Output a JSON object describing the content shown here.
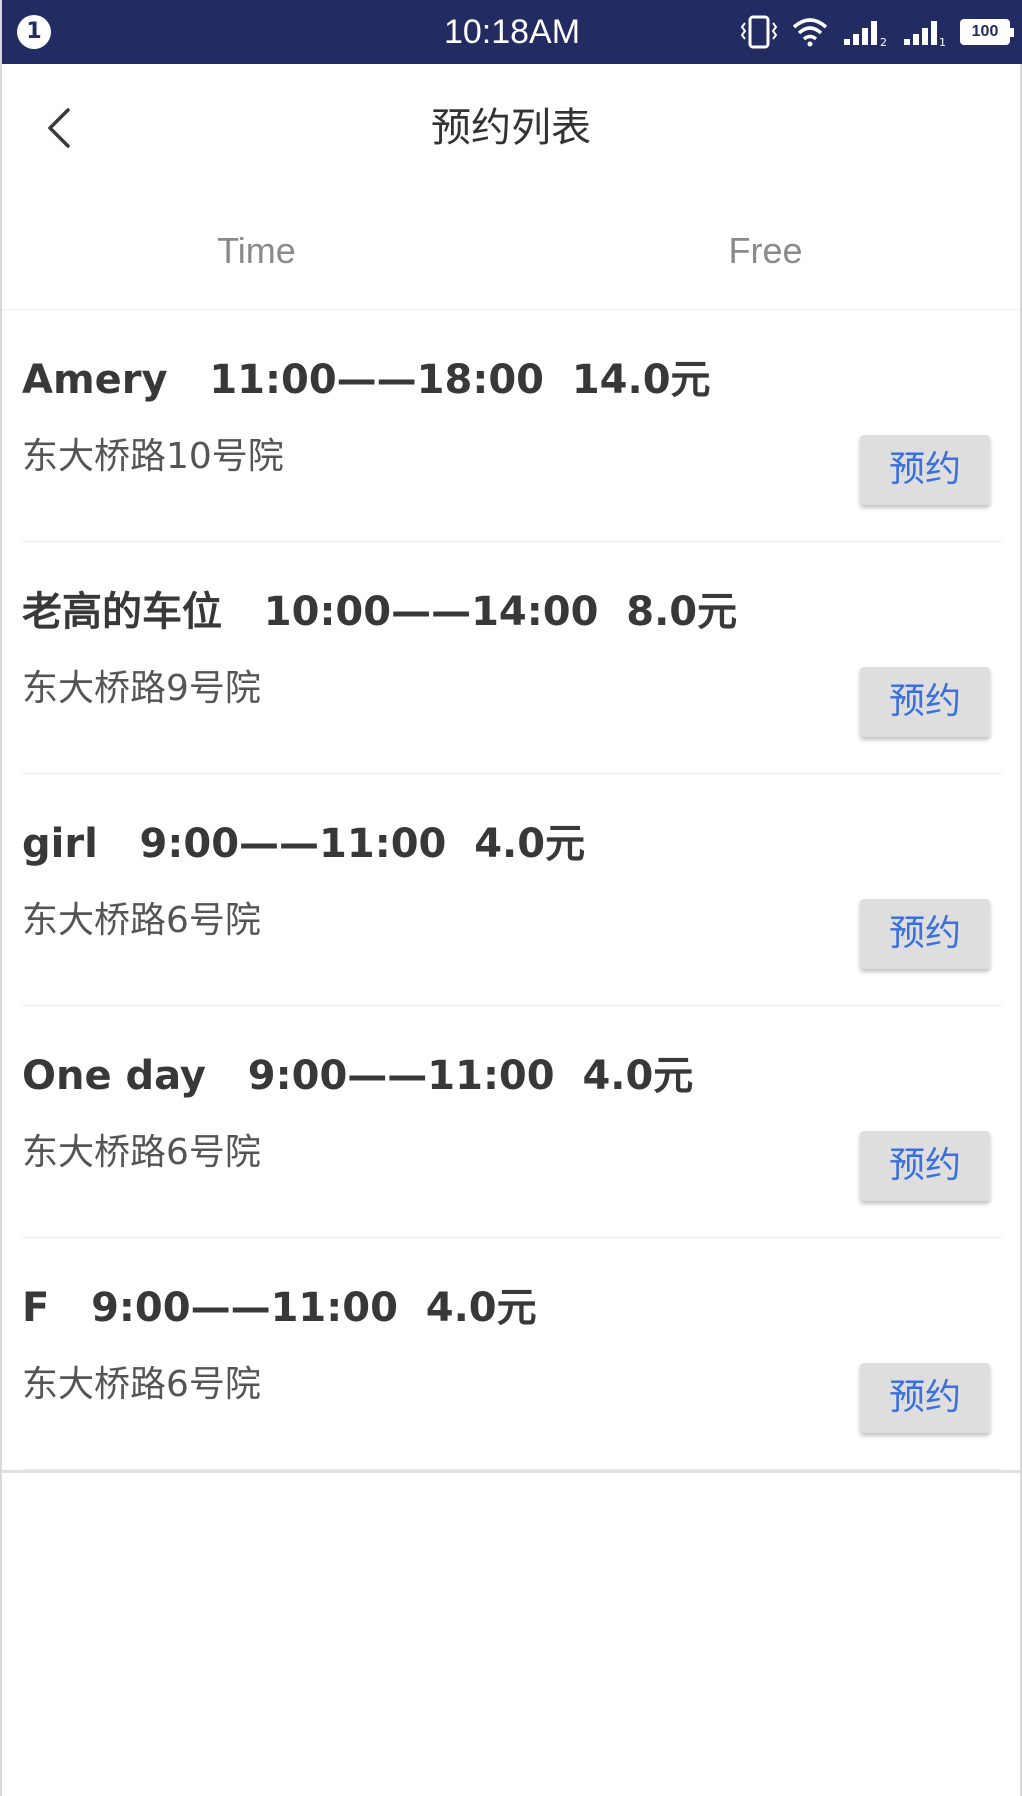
{
  "status_bar": {
    "notification_count": "1",
    "time": "10:18AM",
    "battery": "100",
    "icons": [
      "vibrate-icon",
      "wifi-icon",
      "signal-sim2-icon",
      "signal-sim1-icon",
      "battery-icon"
    ]
  },
  "header": {
    "title": "预约列表",
    "back_icon": "chevron-left-icon"
  },
  "tabs": [
    {
      "label": "Time"
    },
    {
      "label": "Free"
    }
  ],
  "list": {
    "items": [
      {
        "title": "Amery   11:00——18:00  14.0元",
        "address": "东大桥路10号院",
        "button": "预约"
      },
      {
        "title": "老高的车位   10:00——14:00  8.0元",
        "address": "东大桥路9号院",
        "button": "预约"
      },
      {
        "title": "girl   9:00——11:00  4.0元",
        "address": "东大桥路6号院",
        "button": "预约"
      },
      {
        "title": "One day   9:00——11:00  4.0元",
        "address": "东大桥路6号院",
        "button": "预约"
      },
      {
        "title": "F   9:00——11:00  4.0元",
        "address": "东大桥路6号院",
        "button": "预约"
      }
    ]
  },
  "colors": {
    "status_bar": "#222c62",
    "button_text": "#3a6fe0",
    "button_bg": "#dedede"
  }
}
